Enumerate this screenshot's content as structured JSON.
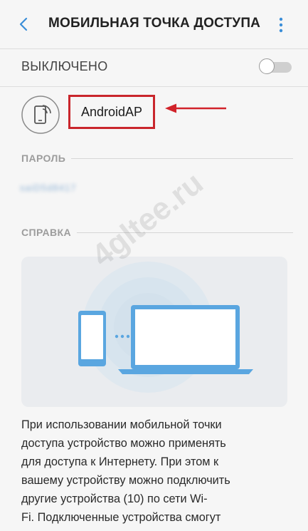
{
  "header": {
    "title": "МОБИЛЬНАЯ ТОЧКА ДОСТУПА",
    "back_icon": "chevron-left-icon",
    "more_icon": "more-vertical-icon"
  },
  "toggle": {
    "label": "ВЫКЛЮЧЕНО",
    "state": "off"
  },
  "network": {
    "name": "AndroidAP",
    "icon": "hotspot-icon"
  },
  "password_section": {
    "header": "ПАРОЛЬ",
    "value": "saiD5d8417"
  },
  "help_section": {
    "header": "СПРАВКА",
    "description": "При использовании мобильной точки\nдоступа устройство можно применять\nдля доступа к Интернету. При этом к\nвашему устройству можно подключить\nдругие устройства (10) по сети Wi-\nFi. Подключенные устройства смогут"
  },
  "watermark": "4gltee.ru",
  "colors": {
    "accent_blue": "#5aa6e0",
    "highlight_red": "#c9262c",
    "background": "#f6f6f6"
  }
}
